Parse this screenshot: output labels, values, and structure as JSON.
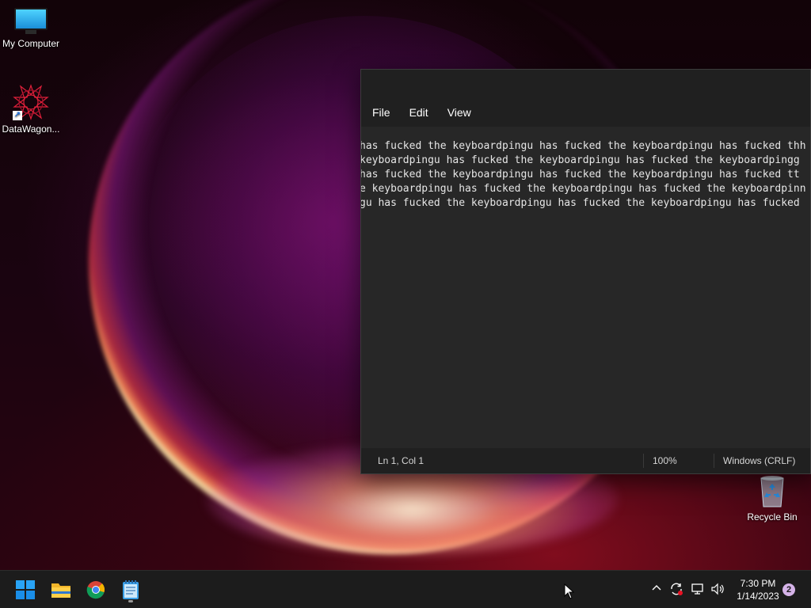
{
  "desktop": {
    "icons": [
      {
        "label": "My Computer",
        "icon": "monitor-icon"
      },
      {
        "label": "DataWagon...",
        "icon": "datawagon-star-icon"
      },
      {
        "label": "Recycle Bin",
        "icon": "recycle-bin-icon"
      }
    ]
  },
  "notepad": {
    "menu": [
      "File",
      "Edit",
      "View"
    ],
    "lines": [
      "has fucked the keyboardpingu has fucked the keyboardpingu has fucked thh",
      " keyboardpingu has fucked the keyboardpingu has fucked the keyboardpingg",
      " has fucked the keyboardpingu has fucked the keyboardpingu has fucked tt",
      "e keyboardpingu has fucked the keyboardpingu has fucked the keyboardpinn",
      "gu has fucked the keyboardpingu has fucked the keyboardpingu has fucked "
    ],
    "status": {
      "position": "Ln 1, Col 1",
      "zoom": "100%",
      "line_ending": "Windows (CRLF)"
    }
  },
  "taskbar": {
    "apps": [
      {
        "name": "start-button",
        "icon": "windows-logo-icon"
      },
      {
        "name": "file-explorer",
        "icon": "folder-icon"
      },
      {
        "name": "chrome",
        "icon": "chrome-icon"
      },
      {
        "name": "notepad",
        "icon": "notepad-icon"
      }
    ],
    "tray": {
      "time": "7:30 PM",
      "date": "1/14/2023",
      "notifications": "2"
    }
  },
  "colors": {
    "taskbar_bg": "#1c1c1c",
    "window_bg": "#272727",
    "menubar_bg": "#202020",
    "accent": "#0a84ff"
  }
}
